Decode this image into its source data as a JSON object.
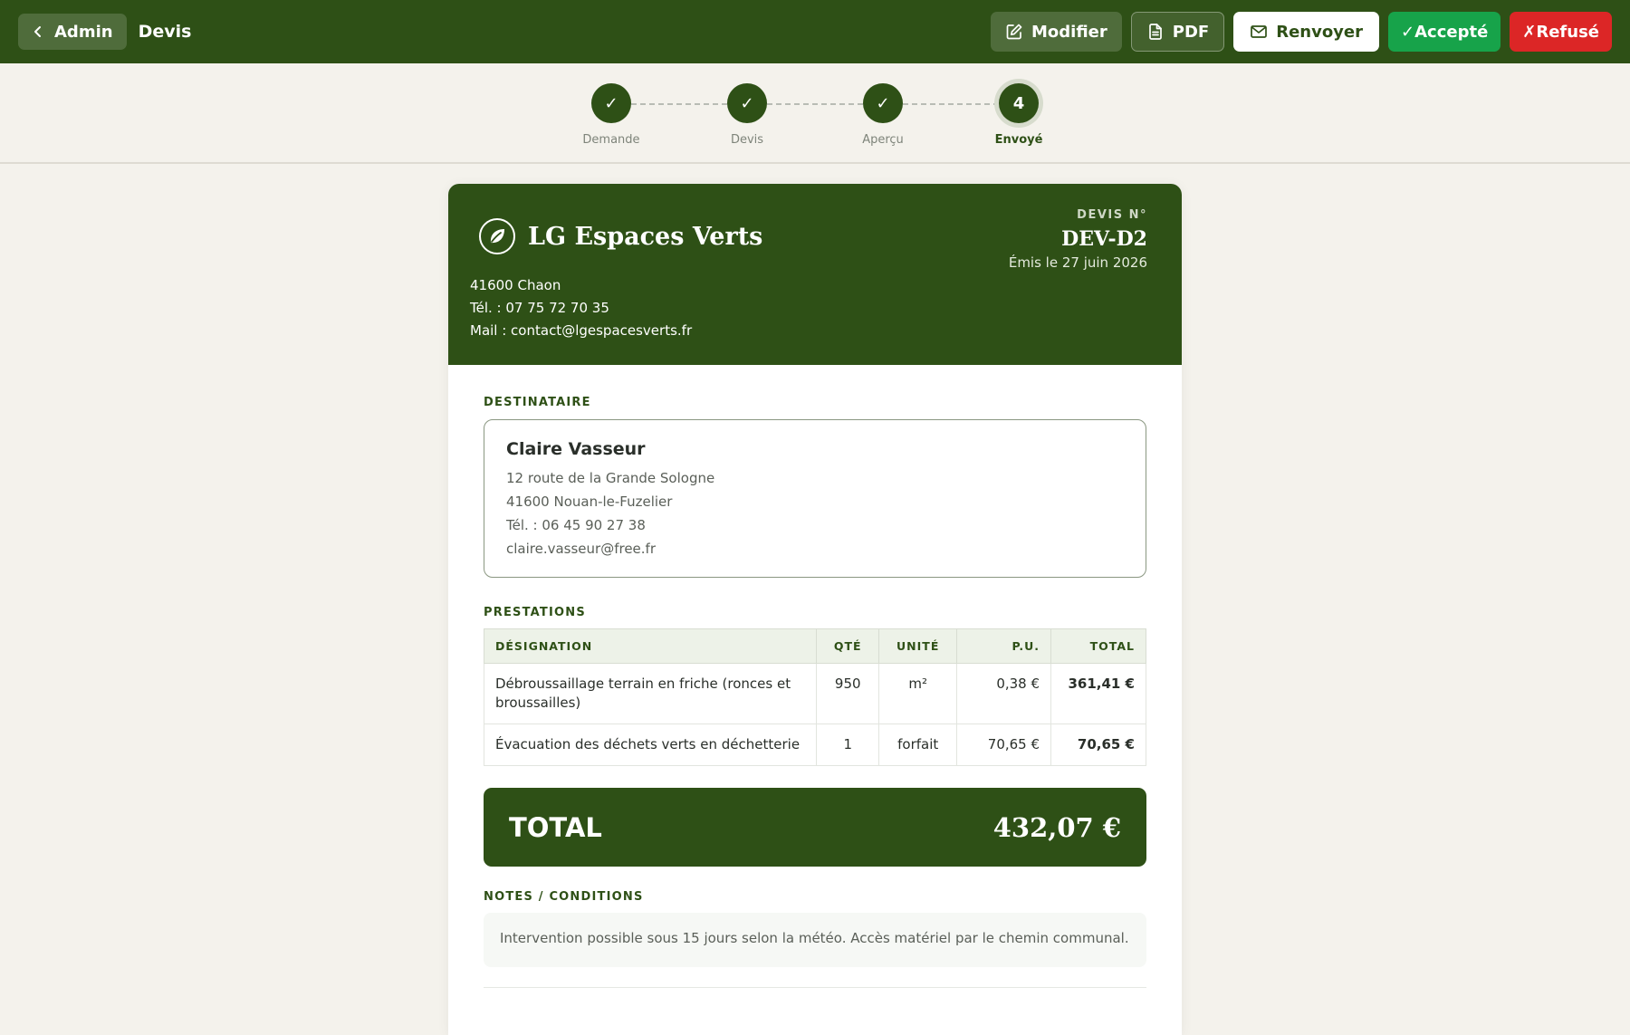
{
  "topbar": {
    "back_label": "Admin",
    "title": "Devis",
    "actions": {
      "edit": "Modifier",
      "pdf": "PDF",
      "resend": "Renvoyer",
      "accepted": "✓Accepté",
      "refused": "✗Refusé"
    },
    "colors": {
      "bar": "#2e5016",
      "accept": "#17a34a",
      "refuse": "#dc2626"
    }
  },
  "stepper": {
    "steps": [
      {
        "label": "Demande",
        "mark": "✓",
        "state": "done"
      },
      {
        "label": "Devis",
        "mark": "✓",
        "state": "done"
      },
      {
        "label": "Aperçu",
        "mark": "✓",
        "state": "done"
      },
      {
        "label": "Envoyé",
        "mark": "4",
        "state": "current"
      }
    ]
  },
  "company": {
    "name": "LG Espaces Verts",
    "logo_icon": "leaf-icon",
    "city": "41600 Chaon",
    "phone": "Tél. : 07 75 72 70 35",
    "email": "Mail : contact@lgespacesverts.fr"
  },
  "quote": {
    "kicker": "DEVIS N°",
    "number": "DEV-D2",
    "issued": "Émis le 27 juin 2026"
  },
  "recipient": {
    "label": "DESTINATAIRE",
    "name": "Claire Vasseur",
    "street": "12 route de la Grande Sologne",
    "city": "41600 Nouan-le-Fuzelier",
    "phone": "Tél. : 06 45 90 27 38",
    "email": "claire.vasseur@free.fr"
  },
  "items": {
    "label": "PRESTATIONS",
    "columns": {
      "designation": "DÉSIGNATION",
      "qty": "QTÉ",
      "unit": "UNITÉ",
      "unit_price": "P.U.",
      "total": "TOTAL"
    },
    "rows": [
      {
        "designation": "Débroussaillage terrain en friche (ronces et broussailles)",
        "qty": "950",
        "unit": "m²",
        "unit_price": "0,38 €",
        "total": "361,41 €"
      },
      {
        "designation": "Évacuation des déchets verts en déchetterie",
        "qty": "1",
        "unit": "forfait",
        "unit_price": "70,65 €",
        "total": "70,65 €"
      }
    ]
  },
  "totals": {
    "label": "TOTAL",
    "value": "432,07 €"
  },
  "notes": {
    "label": "NOTES / CONDITIONS",
    "text": "Intervention possible sous 15 jours selon la météo. Accès matériel par le chemin communal."
  }
}
